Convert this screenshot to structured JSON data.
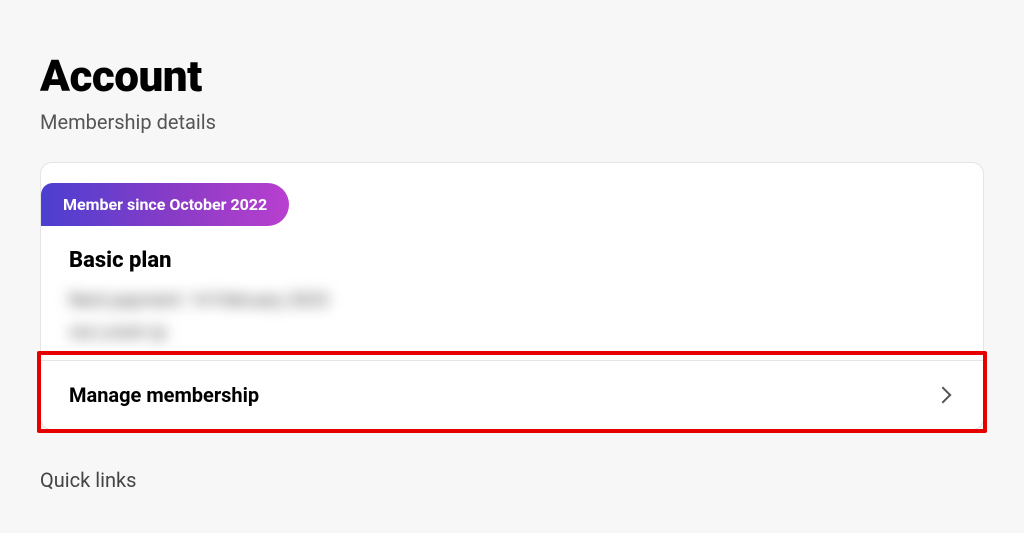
{
  "header": {
    "title": "Account",
    "subtitle": "Membership details"
  },
  "card": {
    "badge": "Member since October 2022",
    "plan_name": "Basic plan",
    "obscured_line1": "Next payment: 14 February 2023",
    "obscured_line2": "via    Lorem ip",
    "manage_label": "Manage membership"
  },
  "footer": {
    "quick_links_label": "Quick links"
  }
}
